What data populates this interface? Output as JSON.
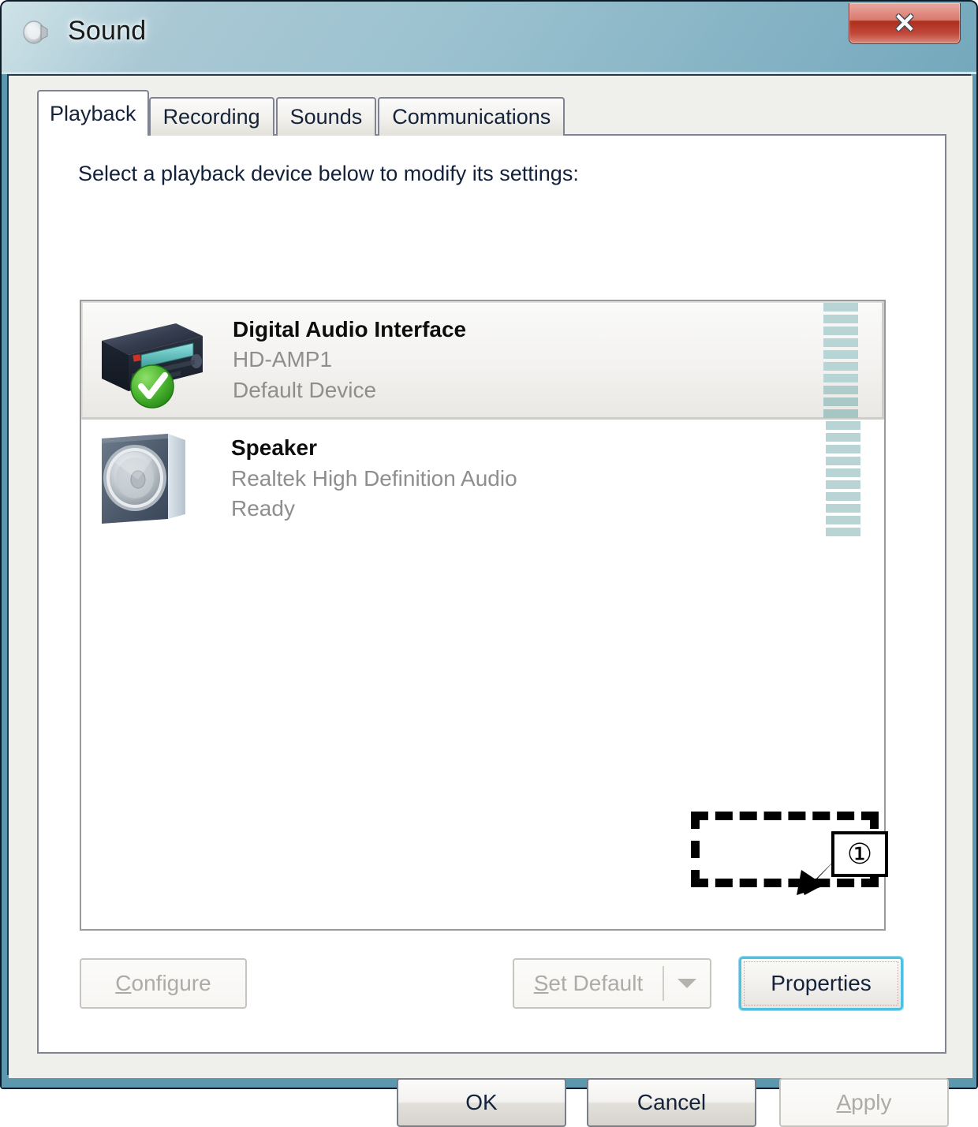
{
  "window": {
    "title": "Sound",
    "title_icon": "speaker-icon",
    "close_label": "x"
  },
  "tabs": [
    {
      "label": "Playback",
      "active": true
    },
    {
      "label": "Recording",
      "active": false
    },
    {
      "label": "Sounds",
      "active": false
    },
    {
      "label": "Communications",
      "active": false
    }
  ],
  "panel": {
    "hint": "Select a playback device below to modify its settings:"
  },
  "devices": [
    {
      "name": "Digital Audio Interface",
      "driver": "HD-AMP1",
      "status": "Default Device",
      "selected": true,
      "is_default": true,
      "icon": "audio-receiver-icon",
      "meter_segments": 10
    },
    {
      "name": "Speaker",
      "driver": "Realtek High Definition Audio",
      "status": "Ready",
      "selected": false,
      "is_default": false,
      "icon": "speaker-box-icon",
      "meter_segments": 10
    }
  ],
  "actions": {
    "configure": {
      "label": "Configure",
      "accel": "C",
      "enabled": false
    },
    "set_default": {
      "label": "Set Default",
      "accel": "S",
      "enabled": false,
      "has_dropdown": true
    },
    "properties": {
      "label": "Properties",
      "enabled": true,
      "focused": true
    }
  },
  "footer": {
    "ok": {
      "label": "OK",
      "enabled": true
    },
    "cancel": {
      "label": "Cancel",
      "enabled": true
    },
    "apply": {
      "label": "Apply",
      "accel": "A",
      "enabled": false
    }
  },
  "annotation": {
    "marker": "①",
    "points_to": "Properties"
  },
  "colors": {
    "frame": "#5d97ad",
    "titlebar_gradient_start": "#cfe3e8",
    "titlebar_gradient_end": "#74a8bc",
    "close_red": "#ad2e1c",
    "dialog_bg": "#eff0ec",
    "panel_bg": "#ffffff",
    "meter_bar": "#b9d4d4",
    "focus_cyan": "#4fc1e0",
    "default_check_green": "#3faa30",
    "muted_text": "#8e8e8e",
    "annotation_black": "#000000"
  }
}
